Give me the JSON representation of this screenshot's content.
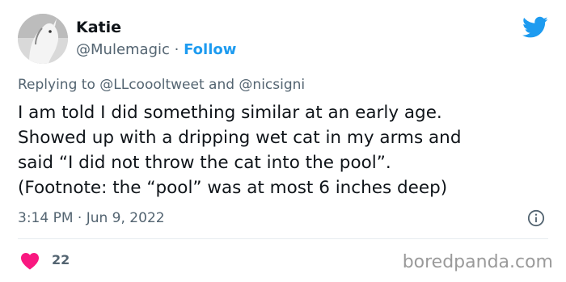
{
  "author": {
    "name": "Katie",
    "handle": "@Mulemagic",
    "separator": "·",
    "follow_label": "Follow"
  },
  "reply": {
    "prefix": "Replying to",
    "mention_1": "@LLcoooltweet",
    "conjunction": "and",
    "mention_2": "@nicsigni"
  },
  "tweet": {
    "lines": [
      "I am told I did something similar at an early age.",
      "Showed up with a dripping wet cat in my arms and",
      "said “I did not throw the cat into the pool”.",
      "(Footnote:  the “pool” was at most 6 inches deep)"
    ],
    "time": "3:14 PM",
    "separator": "·",
    "date": "Jun 9, 2022"
  },
  "engagement": {
    "likes": "22"
  },
  "watermark": "boredpanda.com",
  "icons": {
    "brand": "twitter-bird-icon",
    "info": "info-icon",
    "like": "heart-icon"
  },
  "colors": {
    "accent": "#1d9bf0",
    "heart": "#f91880",
    "secondary_text": "#536471",
    "primary_text": "#0f1419",
    "watermark": "#9a9a9a"
  }
}
